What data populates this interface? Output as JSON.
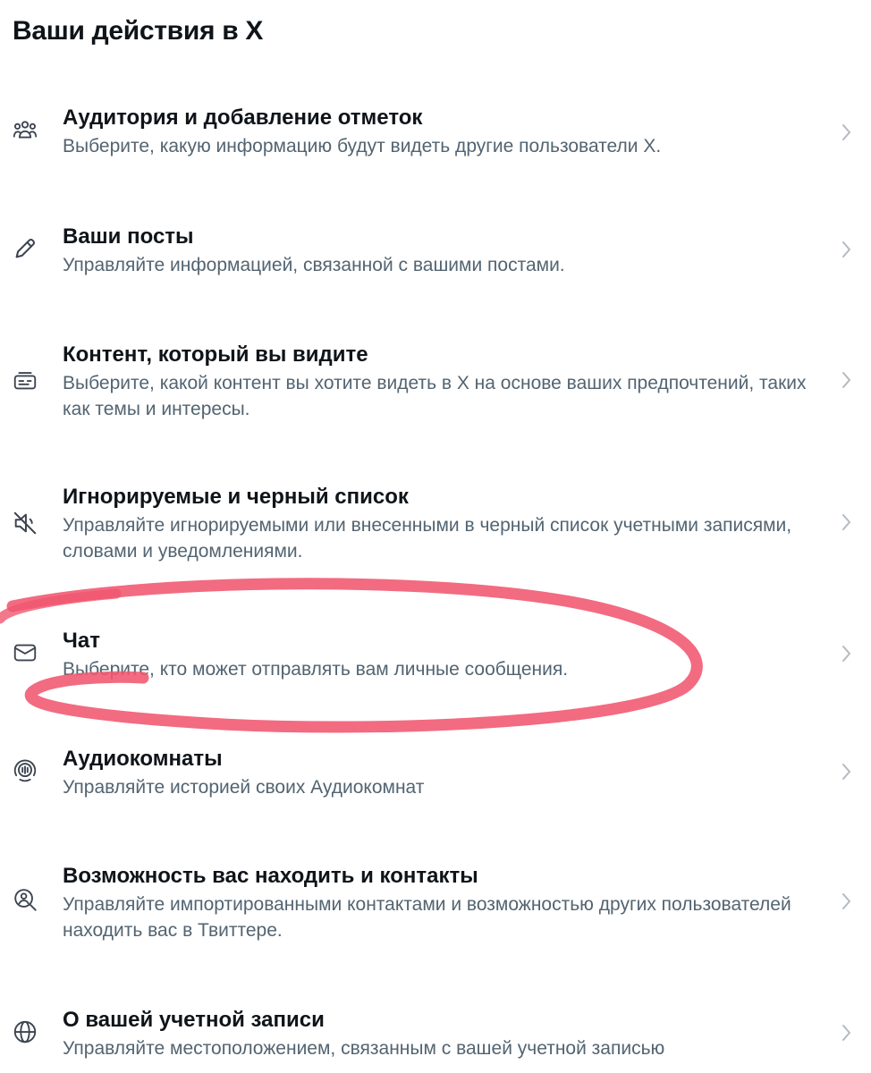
{
  "page": {
    "title": "Ваши действия в X"
  },
  "items": [
    {
      "icon": "people-icon",
      "title": "Аудитория и добавление отметок",
      "description": "Выберите, какую информацию будут видеть другие пользователи X."
    },
    {
      "icon": "pencil-icon",
      "title": "Ваши посты",
      "description": "Управляйте информацией, связанной с вашими постами."
    },
    {
      "icon": "content-card-icon",
      "title": "Контент, который вы видите",
      "description": "Выберите, какой контент вы хотите видеть в X на основе ваших предпочтений, таких как темы и интересы."
    },
    {
      "icon": "mute-icon",
      "title": "Игнорируемые и черный список",
      "description": "Управляйте игнорируемыми или внесенными в черный список учетными записями, словами и уведомлениями."
    },
    {
      "icon": "envelope-icon",
      "title": "Чат",
      "description": "Выберите, кто может отправлять вам личные сообщения."
    },
    {
      "icon": "audio-space-icon",
      "title": "Аудиокомнаты",
      "description": "Управляйте историей своих Аудиокомнат"
    },
    {
      "icon": "find-contacts-icon",
      "title": "Возможность вас находить и контакты",
      "description": "Управляйте импортированными контактами и возможностью других пользователей находить вас в Твиттере."
    },
    {
      "icon": "globe-icon",
      "title": "О вашей учетной записи",
      "description": "Управляйте местоположением, связанным с вашей учетной записью"
    }
  ],
  "annotation": {
    "highlighted_item": "Чат",
    "color": "#f0566f"
  },
  "colors": {
    "title": "#0f1419",
    "secondary_text": "#536471",
    "icon": "#3c4450",
    "chevron": "#b3bac1"
  }
}
